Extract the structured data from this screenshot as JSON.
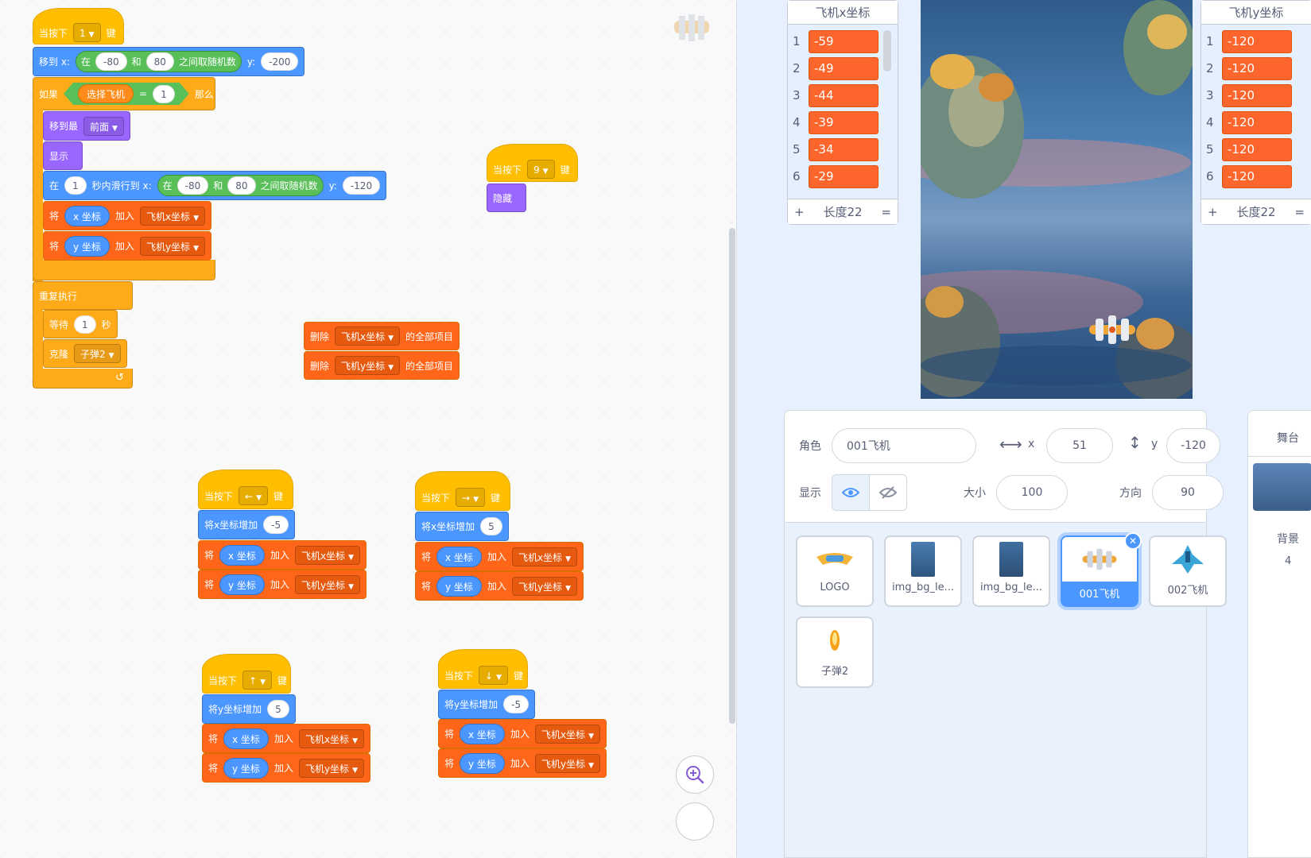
{
  "script_blocks": {
    "s1": {
      "hat_prefix": "当按下",
      "hat_key": "1",
      "hat_suffix": "键",
      "goto_prefix": "移到 x:",
      "goto_random_prefix": "在",
      "goto_random_min": "-80",
      "goto_random_and": "和",
      "goto_random_max": "80",
      "goto_random_suffix": "之间取随机数",
      "goto_y_label": "y:",
      "goto_y": "-200",
      "if_label": "如果",
      "cond_var": "选择飞机",
      "cond_op": "=",
      "cond_val": "1",
      "then_label": "那么",
      "front_label": "移到最",
      "front_opt": "前面",
      "show_label": "显示",
      "glide_in": "在",
      "glide_secs": "1",
      "glide_mid": "秒内滑行到 x:",
      "glide_random_prefix": "在",
      "glide_random_min": "-80",
      "glide_random_and": "和",
      "glide_random_max": "80",
      "glide_random_suffix": "之间取随机数",
      "glide_y_label": "y:",
      "glide_y": "-120",
      "add1_put": "将",
      "add1_rep": "x 坐标",
      "add1_mid": "加入",
      "add1_list": "飞机x坐标",
      "add2_put": "将",
      "add2_rep": "y 坐标",
      "add2_mid": "加入",
      "add2_list": "飞机y坐标",
      "forever_label": "重复执行",
      "wait_label": "等待",
      "wait_val": "1",
      "wait_unit": "秒",
      "clone_label": "克隆",
      "clone_opt": "子弹2"
    },
    "s2": {
      "hat_prefix": "当按下",
      "hat_key": "9",
      "hat_suffix": "键",
      "hide_label": "隐藏"
    },
    "s3": {
      "del1_label": "删除",
      "del1_list": "飞机x坐标",
      "del1_suffix": "的全部项目",
      "del2_label": "删除",
      "del2_list": "飞机y坐标",
      "del2_suffix": "的全部项目"
    },
    "s4": {
      "hat_prefix": "当按下",
      "hat_key": "←",
      "hat_suffix": "键",
      "change_label": "将x坐标增加",
      "change_val": "-5",
      "a1_put": "将",
      "a1_rep": "x 坐标",
      "a1_mid": "加入",
      "a1_list": "飞机x坐标",
      "a2_put": "将",
      "a2_rep": "y 坐标",
      "a2_mid": "加入",
      "a2_list": "飞机y坐标"
    },
    "s5": {
      "hat_prefix": "当按下",
      "hat_key": "→",
      "hat_suffix": "键",
      "change_label": "将x坐标增加",
      "change_val": "5",
      "a1_put": "将",
      "a1_rep": "x 坐标",
      "a1_mid": "加入",
      "a1_list": "飞机x坐标",
      "a2_put": "将",
      "a2_rep": "y 坐标",
      "a2_mid": "加入",
      "a2_list": "飞机y坐标"
    },
    "s6": {
      "hat_prefix": "当按下",
      "hat_key": "↑",
      "hat_suffix": "键",
      "change_label": "将y坐标增加",
      "change_val": "5",
      "a1_put": "将",
      "a1_rep": "x 坐标",
      "a1_mid": "加入",
      "a1_list": "飞机x坐标",
      "a2_put": "将",
      "a2_rep": "y 坐标",
      "a2_mid": "加入",
      "a2_list": "飞机y坐标"
    },
    "s7": {
      "hat_prefix": "当按下",
      "hat_key": "↓",
      "hat_suffix": "键",
      "change_label": "将y坐标增加",
      "change_val": "-5",
      "a1_put": "将",
      "a1_rep": "x 坐标",
      "a1_mid": "加入",
      "a1_list": "飞机x坐标",
      "a2_put": "将",
      "a2_rep": "y 坐标",
      "a2_mid": "加入",
      "a2_list": "飞机y坐标"
    }
  },
  "monitors": {
    "x_list": {
      "title": "飞机x坐标",
      "rows": [
        {
          "i": "1",
          "v": "-59"
        },
        {
          "i": "2",
          "v": "-49"
        },
        {
          "i": "3",
          "v": "-44"
        },
        {
          "i": "4",
          "v": "-39"
        },
        {
          "i": "5",
          "v": "-34"
        },
        {
          "i": "6",
          "v": "-29"
        }
      ],
      "add": "+",
      "length": "长度22",
      "resize": "="
    },
    "y_list": {
      "title": "飞机y坐标",
      "rows": [
        {
          "i": "1",
          "v": "-120"
        },
        {
          "i": "2",
          "v": "-120"
        },
        {
          "i": "3",
          "v": "-120"
        },
        {
          "i": "4",
          "v": "-120"
        },
        {
          "i": "5",
          "v": "-120"
        },
        {
          "i": "6",
          "v": "-120"
        }
      ],
      "add": "+",
      "length": "长度22",
      "resize": "="
    }
  },
  "sprite_info": {
    "sprite_label": "角色",
    "sprite_name": "001飞机",
    "x_label": "x",
    "x_value": "51",
    "y_label": "y",
    "y_value": "-120",
    "show_label": "显示",
    "size_label": "大小",
    "size_value": "100",
    "direction_label": "方向",
    "direction_value": "90"
  },
  "sprites": [
    {
      "name": "LOGO"
    },
    {
      "name": "img_bg_le..."
    },
    {
      "name": "img_bg_le..."
    },
    {
      "name": "001飞机"
    },
    {
      "name": "002飞机"
    },
    {
      "name": "子弹2"
    }
  ],
  "stage_panel": {
    "title": "舞台",
    "backdrops_label": "背景",
    "backdrops_count": "4"
  },
  "colors": {
    "events": "#ffbf00",
    "motion": "#4c97ff",
    "looks": "#9966ff",
    "control": "#ffab19",
    "variables": "#ff661a",
    "operators": "#59c059",
    "selected": "#4c97ff"
  }
}
